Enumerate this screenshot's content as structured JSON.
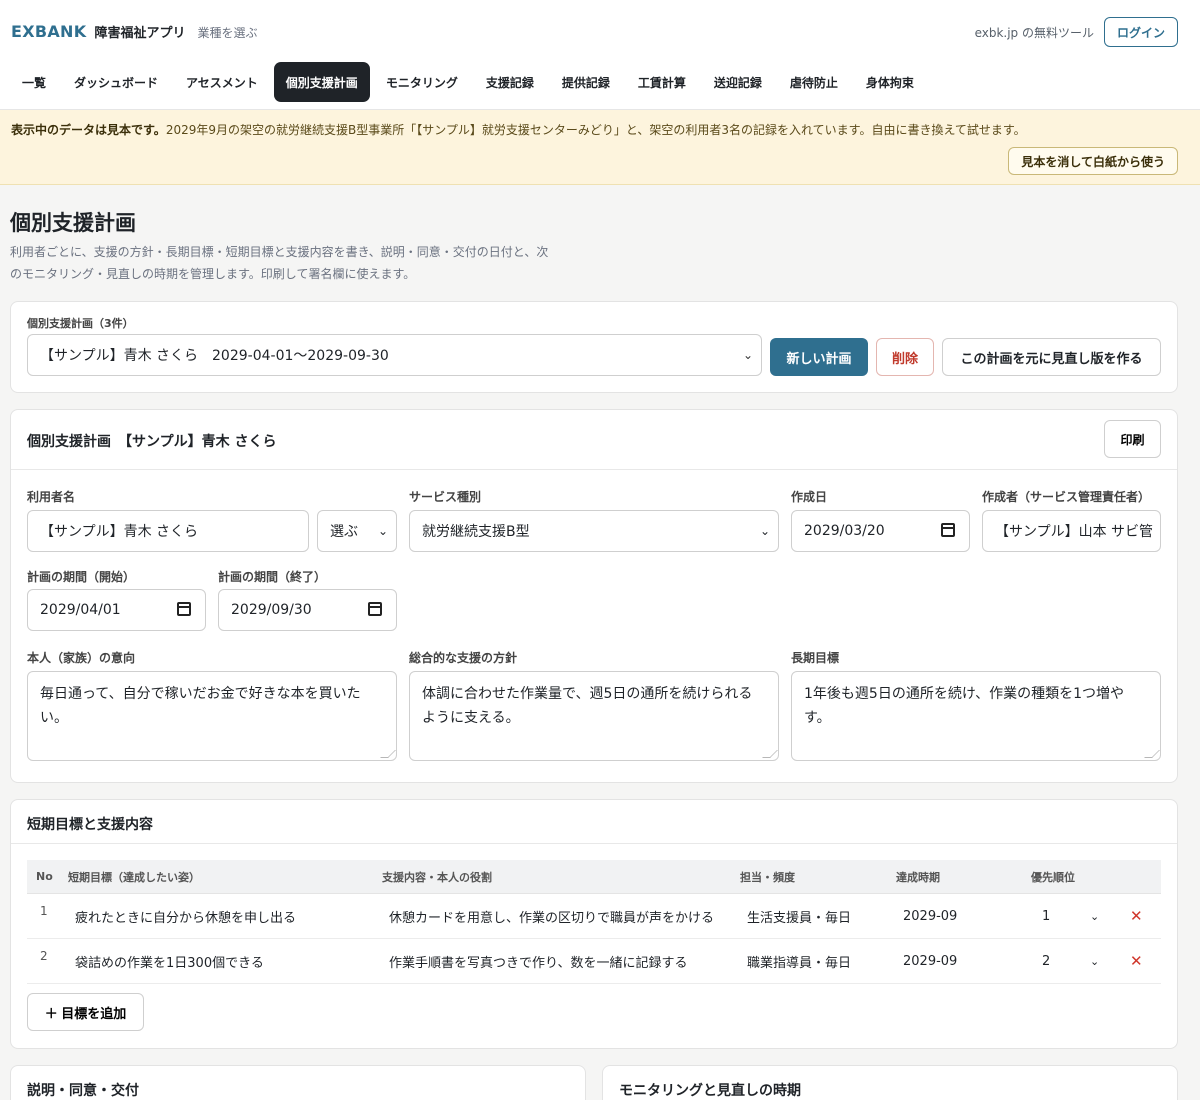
{
  "header": {
    "brand": "EXBANK",
    "app_name": "障害福祉アプリ",
    "industry_link": "業種を選ぶ",
    "free_tool": "exbk.jp の無料ツール",
    "login": "ログイン"
  },
  "nav": {
    "items": [
      "一覧",
      "ダッシュボード",
      "アセスメント",
      "個別支援計画",
      "モニタリング",
      "支援記録",
      "提供記録",
      "工賃計算",
      "送迎記録",
      "虐待防止",
      "身体拘束"
    ],
    "active": "個別支援計画"
  },
  "banner": {
    "bold": "表示中のデータは見本です。",
    "text": "2029年9月の架空の就労継続支援B型事業所「【サンプル】就労支援センターみどり」と、架空の利用者3名の記録を入れています。自由に書き換えて試せます。",
    "clear_button": "見本を消して白紙から使う"
  },
  "page": {
    "title": "個別支援計画",
    "description": "利用者ごとに、支援の方針・長期目標・短期目標と支援内容を書き、説明・同意・交付の日付と、次のモニタリング・見直しの時期を管理します。印刷して署名欄に使えます。"
  },
  "plan_select": {
    "label": "個別支援計画（3件）",
    "selected": "【サンプル】青木 さくら　2029-04-01〜2029-09-30",
    "new_button": "新しい計画",
    "delete_button": "削除",
    "revise_button": "この計画を元に見直し版を作る"
  },
  "plan": {
    "heading": "個別支援計画　【サンプル】青木 さくら",
    "print_button": "印刷",
    "user_label": "利用者名",
    "user_value": "【サンプル】青木 さくら",
    "user_pick": "選ぶ",
    "service_label": "サービス種別",
    "service_value": "就労継続支援B型",
    "created_label": "作成日",
    "created_value": "2029/03/20",
    "author_label": "作成者（サービス管理責任者）",
    "author_value": "【サンプル】山本 サビ管",
    "start_label": "計画の期間（開始）",
    "start_value": "2029/04/01",
    "end_label": "計画の期間（終了）",
    "end_value": "2029/09/30",
    "wish_label": "本人（家族）の意向",
    "wish_value": "毎日通って、自分で稼いだお金で好きな本を買いたい。",
    "policy_label": "総合的な支援の方針",
    "policy_value": "体調に合わせた作業量で、週5日の通所を続けられるように支える。",
    "long_goal_label": "長期目標",
    "long_goal_value": "1年後も週5日の通所を続け、作業の種類を1つ増やす。"
  },
  "goals": {
    "heading": "短期目標と支援内容",
    "columns": {
      "no": "No",
      "goal": "短期目標（達成したい姿）",
      "support": "支援内容・本人の役割",
      "staff": "担当・頻度",
      "due": "達成時期",
      "priority": "優先順位"
    },
    "rows": [
      {
        "no": "1",
        "goal": "疲れたときに自分から休憩を申し出る",
        "support": "休憩カードを用意し、作業の区切りで職員が声をかける",
        "staff": "生活支援員・毎日",
        "due": "2029-09",
        "priority": "1"
      },
      {
        "no": "2",
        "goal": "袋詰めの作業を1日300個できる",
        "support": "作業手順書を写真つきで作り、数を一緒に記録する",
        "staff": "職業指導員・毎日",
        "due": "2029-09",
        "priority": "2"
      }
    ],
    "add_button": "＋ 目標を追加"
  },
  "bottom": {
    "consent_heading": "説明・同意・交付",
    "monitoring_heading": "モニタリングと見直しの時期"
  }
}
